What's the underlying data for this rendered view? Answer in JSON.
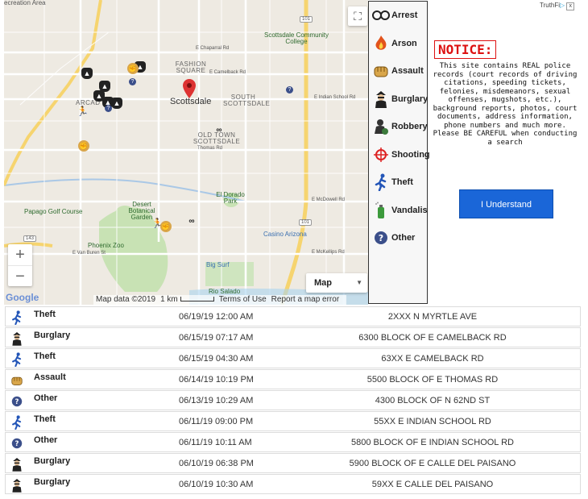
{
  "map": {
    "labels": {
      "recreation_area": "ecreation Area",
      "fashion_square": "FASHION SQUARE",
      "arcadia": "ARCAD",
      "scottsdale": "Scottsdale",
      "scottsdale_cc": "Scottsdale Community College",
      "south_scottsdale": "SOUTH SCOTTSDALE",
      "old_town": "OLD TOWN SCOTTSDALE",
      "el_dorado_park": "El Dorado Park",
      "papago_golf": "Papago Golf Course",
      "desert_botanical": "Desert Botanical Garden",
      "phoenix_zoo": "Phoenix Zoo",
      "casino_arizona": "Casino Arizona",
      "big_surf": "Big Surf",
      "rio_salado": "Rio Salado",
      "chaparral_rd": "E Chaparral Rd",
      "camelback_rd": "E Camelback Rd",
      "indian_school_rd": "E Indian School Rd",
      "thomas_rd": "Thomas Rd",
      "mcdowell_rd": "E McDowell Rd",
      "mckellips_rd": "E McKellips Rd",
      "van_buren": "E Van Buren St",
      "hwy_101": "101",
      "hwy_143": "143"
    },
    "map_type": "Map",
    "zoom_in": "+",
    "zoom_out": "−",
    "google": "Google",
    "attribution": {
      "data": "Map data ©2019",
      "scale": "1 km",
      "terms": "Terms of Use",
      "report": "Report a map error"
    }
  },
  "legend": [
    {
      "key": "arrest",
      "label": "Arrest"
    },
    {
      "key": "arson",
      "label": "Arson"
    },
    {
      "key": "assault",
      "label": "Assault"
    },
    {
      "key": "burglary",
      "label": "Burglary"
    },
    {
      "key": "robbery",
      "label": "Robbery"
    },
    {
      "key": "shooting",
      "label": "Shooting"
    },
    {
      "key": "theft",
      "label": "Theft"
    },
    {
      "key": "vandalism",
      "label": "Vandalis"
    },
    {
      "key": "other",
      "label": "Other"
    }
  ],
  "ad": {
    "brand": "TruthFi",
    "close": "x"
  },
  "notice": {
    "title": "NOTICE:",
    "text": "This site contains REAL police records (court records of driving citations, speeding tickets, felonies, misdemeanors, sexual offenses, mugshots, etc.), background reports, photos, court documents, address information, phone numbers and much more. Please BE CAREFUL when conducting a search",
    "button": "I Understand"
  },
  "incidents": [
    {
      "type": "theft",
      "category": "Theft",
      "datetime": "06/19/19 12:00 AM",
      "address": "2XXX N MYRTLE AVE"
    },
    {
      "type": "burglary",
      "category": "Burglary",
      "datetime": "06/15/19 07:17 AM",
      "address": "6300 BLOCK OF E CAMELBACK RD"
    },
    {
      "type": "theft",
      "category": "Theft",
      "datetime": "06/15/19 04:30 AM",
      "address": "63XX E CAMELBACK RD"
    },
    {
      "type": "assault",
      "category": "Assault",
      "datetime": "06/14/19 10:19 PM",
      "address": "5500 BLOCK OF E THOMAS RD"
    },
    {
      "type": "other",
      "category": "Other",
      "datetime": "06/13/19 10:29 AM",
      "address": "4300 BLOCK OF N 62ND ST"
    },
    {
      "type": "theft",
      "category": "Theft",
      "datetime": "06/11/19 09:00 PM",
      "address": "55XX E INDIAN SCHOOL RD"
    },
    {
      "type": "other",
      "category": "Other",
      "datetime": "06/11/19 10:11 AM",
      "address": "5800 BLOCK OF E INDIAN SCHOOL RD"
    },
    {
      "type": "burglary",
      "category": "Burglary",
      "datetime": "06/10/19 06:38 PM",
      "address": "5900 BLOCK OF E CALLE DEL PAISANO"
    },
    {
      "type": "burglary",
      "category": "Burglary",
      "datetime": "06/10/19 10:30 AM",
      "address": "59XX E CALLE DEL PAISANO"
    }
  ],
  "colors": {
    "accent_button": "#1a66d8",
    "notice_red": "#dd1111",
    "theft_blue": "#2456b8",
    "other_blue": "#3b4f8a"
  }
}
